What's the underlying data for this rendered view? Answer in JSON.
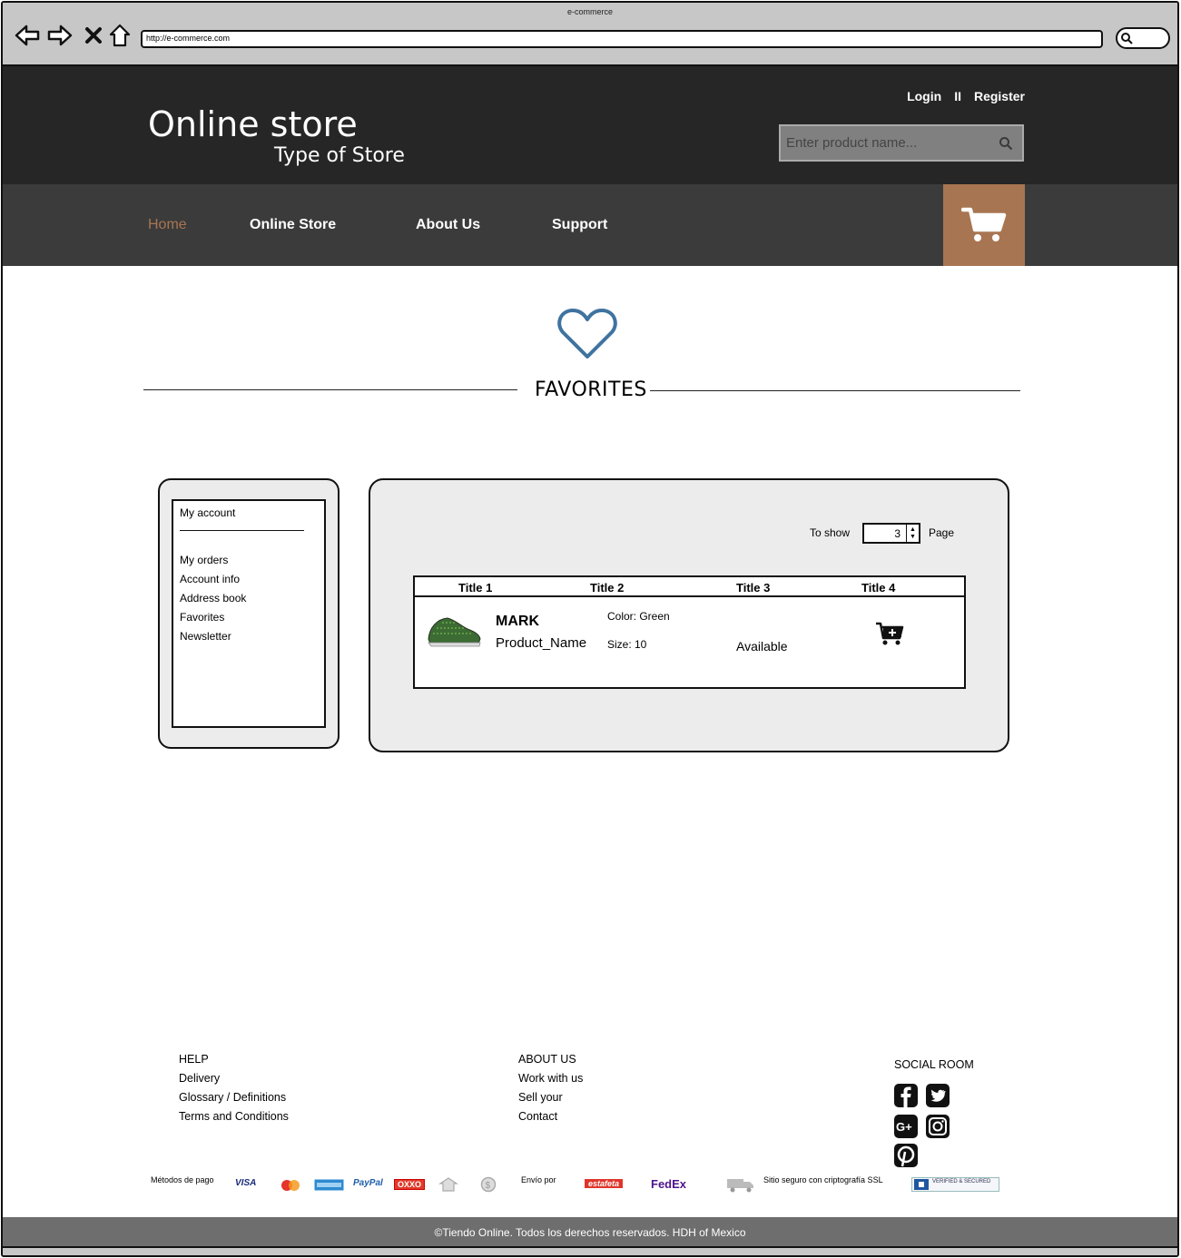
{
  "browser": {
    "title": "e-commerce",
    "url": "http://e-commerce.com"
  },
  "header": {
    "store_title": "Online store",
    "store_type": "Type of Store",
    "login": "Login",
    "separator": "II",
    "register": "Register",
    "search_placeholder": "Enter product name..."
  },
  "nav": {
    "items": [
      {
        "label": "Home",
        "active": true
      },
      {
        "label": "Online Store",
        "active": false
      },
      {
        "label": "About Us",
        "active": false
      },
      {
        "label": "Support",
        "active": false
      }
    ],
    "accent": "#a87552"
  },
  "favorites": {
    "title": "FAVORITES",
    "icon": "heart-icon",
    "icon_color": "#3f73a0"
  },
  "account_menu": {
    "header": "My account",
    "items": [
      "My orders",
      "Account info",
      "Address book",
      "Favorites",
      "Newsletter"
    ]
  },
  "pager": {
    "to_show_label": "To show",
    "count": "3",
    "page_label": "Page"
  },
  "table": {
    "headers": [
      "Title 1",
      "Title 2",
      "Title 3",
      "Title 4"
    ],
    "row": {
      "brand": "MARK",
      "name": "Product_Name",
      "color": "Color: Green",
      "size": "Size: 10",
      "availability": "Available"
    }
  },
  "footer": {
    "help": {
      "title": "HELP",
      "links": [
        "Delivery",
        "Glossary / Definitions",
        "Terms and Conditions"
      ]
    },
    "about": {
      "title": "ABOUT US",
      "links": [
        "Work with us",
        "Sell your",
        "Contact"
      ]
    },
    "social": {
      "title": "SOCIAL ROOM",
      "icons": [
        "facebook-icon",
        "twitter-icon",
        "google-plus-icon",
        "instagram-icon",
        "pinterest-icon"
      ]
    },
    "payment_label": "Métodos de pago",
    "payment_methods": [
      "VISA",
      "PayPal",
      "OXXO"
    ],
    "shipping_label": "Envío por",
    "carriers": [
      "estafeta",
      "FedEx"
    ],
    "ssl_label": "Sitio seguro con criptografía SSL",
    "ssl_badge": "VERIFIED & SECURED",
    "copyright": "©Tiendo Online. Todos los derechos reservados. HDH of Mexico"
  }
}
